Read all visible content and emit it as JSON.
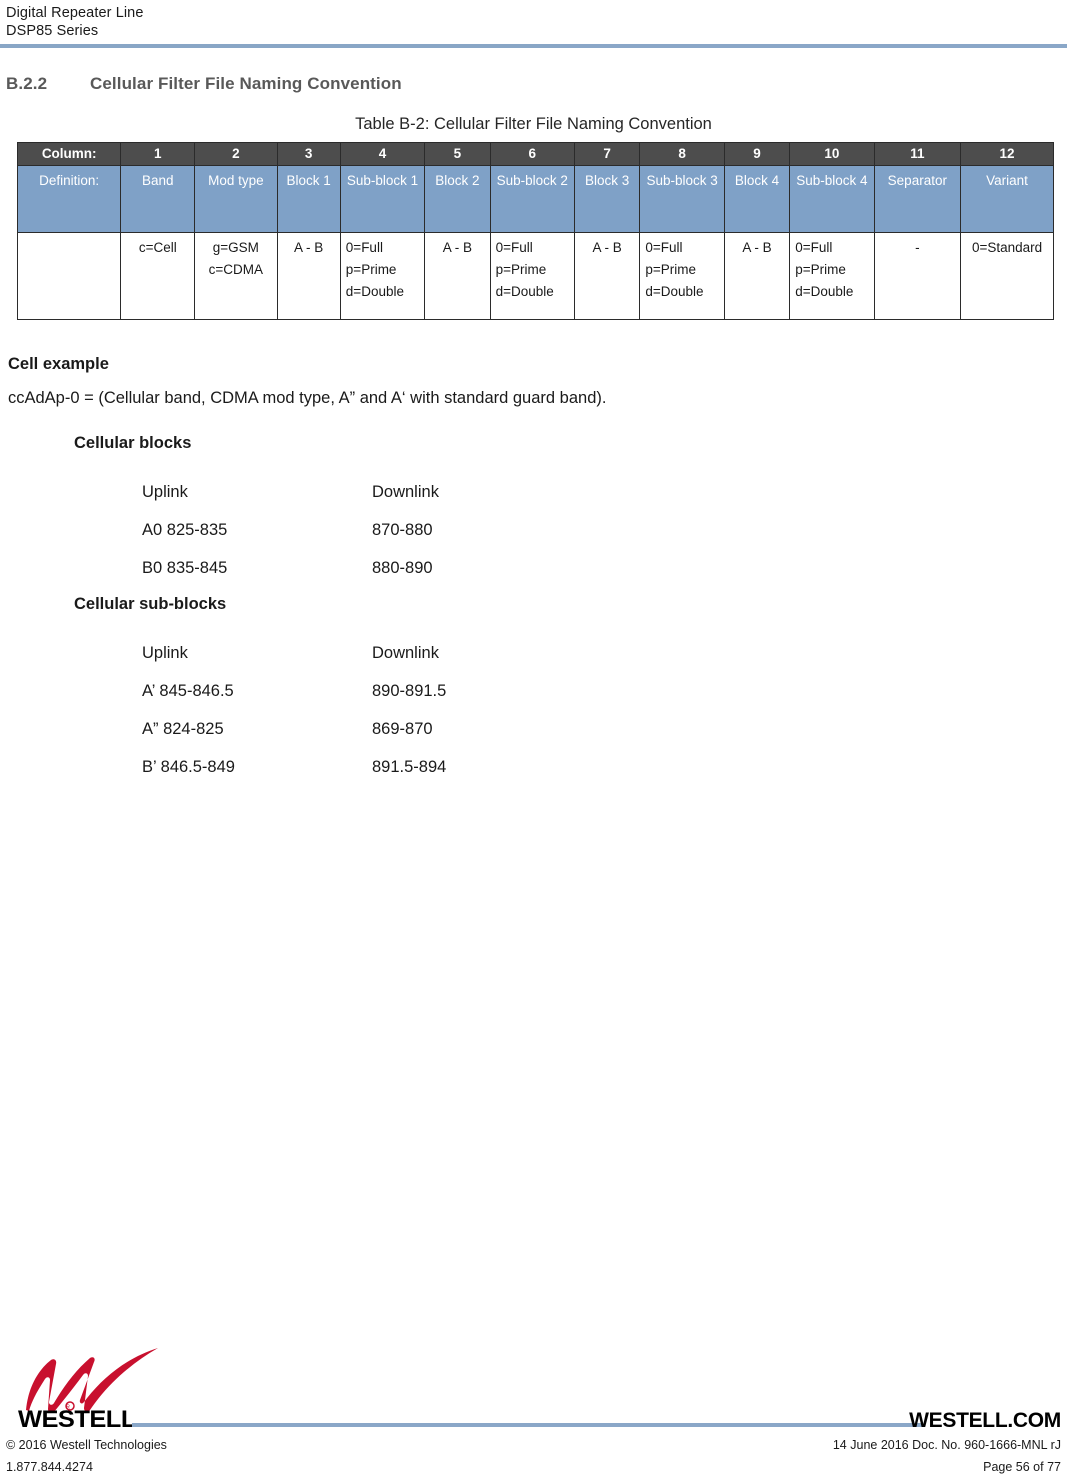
{
  "header": {
    "line1": "Digital Repeater Line",
    "line2": "DSP85 Series",
    "rule_color": "#8aa7c8"
  },
  "section": {
    "number": "B.2.2",
    "title": "Cellular Filter File Naming Convention"
  },
  "table": {
    "caption": "Table B-2: Cellular Filter File Naming Convention",
    "header_bg": "#4d4d4d",
    "definition_bg": "#7fa1c7",
    "column_row_label": "Column:",
    "column_numbers": [
      "1",
      "2",
      "3",
      "4",
      "5",
      "6",
      "7",
      "8",
      "9",
      "10",
      "11",
      "12"
    ],
    "definition_row_label": "Definition:",
    "definitions": [
      "Band",
      "Mod type",
      "Block 1",
      "Sub-block 1",
      "Block 2",
      "Sub-block 2",
      "Block 3",
      "Sub-block 3",
      "Block 4",
      "Sub-block 4",
      "Separator",
      "Variant"
    ],
    "values_row_label": "",
    "values": [
      [
        "c=Cell"
      ],
      [
        "g=GSM",
        "c=CDMA"
      ],
      [
        "A - B"
      ],
      [
        "0=Full",
        "p=Prime",
        "d=Double"
      ],
      [
        "A - B"
      ],
      [
        "0=Full",
        "p=Prime",
        "d=Double"
      ],
      [
        "A - B"
      ],
      [
        "0=Full",
        "p=Prime",
        "d=Double"
      ],
      [
        "A - B"
      ],
      [
        "0=Full",
        "p=Prime",
        "d=Double"
      ],
      [
        "-"
      ],
      [
        "0=Standard"
      ]
    ]
  },
  "cell_example": {
    "title": "Cell example",
    "text": "ccAdAp-0 = (Cellular band, CDMA mod type, A” and A‘ with standard guard band).",
    "blocks": {
      "title": "Cellular blocks",
      "col_a_header": "Uplink",
      "col_b_header": "Downlink",
      "rows": [
        {
          "uplink": "A0 825-835",
          "downlink": "870-880"
        },
        {
          "uplink": "B0 835-845",
          "downlink": "880-890"
        }
      ]
    },
    "sub_blocks": {
      "title": "Cellular sub-blocks",
      "col_a_header": "Uplink",
      "col_b_header": "Downlink",
      "rows": [
        {
          "uplink": "A’ 845-846.5",
          "downlink": "890-891.5"
        },
        {
          "uplink": "A” 824-825",
          "downlink": "869-870"
        },
        {
          "uplink": "B’ 846.5-849",
          "downlink": "891.5-894"
        }
      ]
    }
  },
  "footer": {
    "logo_word": "WESTELL",
    "logo_color": "#c8102e",
    "brand_url": "WESTELL.COM",
    "copyright": "© 2016 Westell Technologies",
    "phone": "1.877.844.4274",
    "doc_info": "14 June 2016 Doc. No. 960-1666-MNL rJ",
    "page_info": "Page 56 of 77",
    "rule_color": "#8aa7c8"
  }
}
